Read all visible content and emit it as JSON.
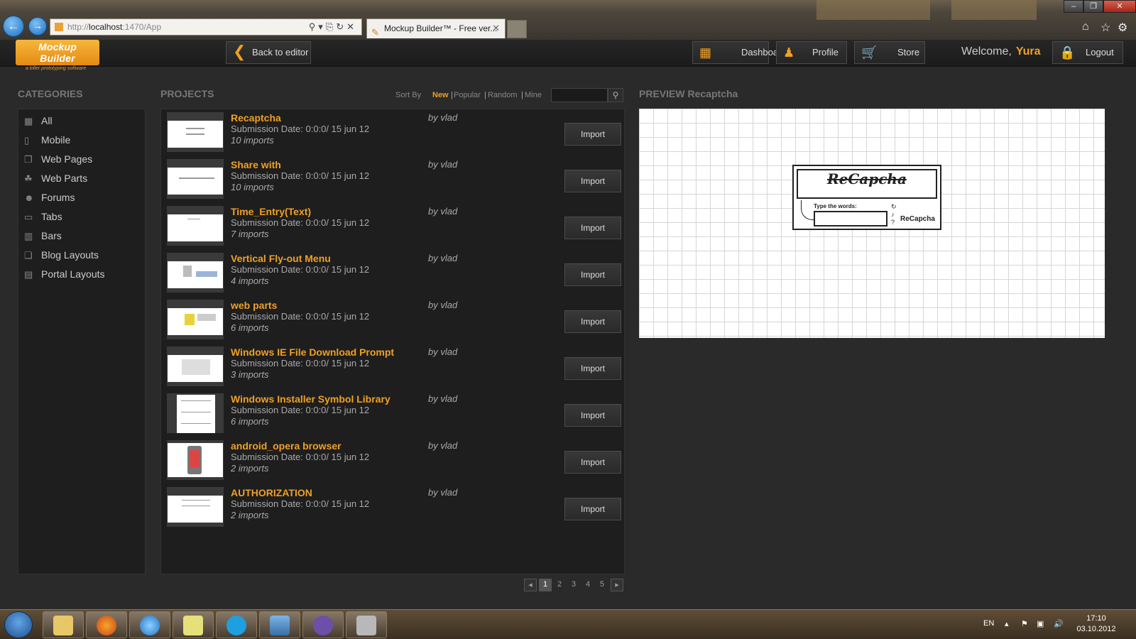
{
  "browser": {
    "url_prefix": "http://",
    "url_host": "localhost",
    "url_rest": ":1470/App",
    "tab_title": "Mockup Builder™ - Free ver...",
    "tab_close": "✕"
  },
  "app": {
    "logo_text": "Mockup Builder",
    "logo_subtitle": "a killer prototyping software",
    "back_label": "Back to editor",
    "dashboard_label": "Dashboard",
    "profile_label": "Profile",
    "store_label": "Store",
    "welcome_text": "Welcome,",
    "username": "Yura",
    "logout_label": "Logout",
    "accent_color": "#f0a024"
  },
  "categories": {
    "title": "CATEGORIES",
    "items": [
      {
        "label": "All",
        "icon": "grid-icon"
      },
      {
        "label": "Mobile",
        "icon": "phone-icon"
      },
      {
        "label": "Web Pages",
        "icon": "pages-icon"
      },
      {
        "label": "Web Parts",
        "icon": "puzzle-icon"
      },
      {
        "label": "Forums",
        "icon": "people-icon"
      },
      {
        "label": "Tabs",
        "icon": "tabs-icon"
      },
      {
        "label": "Bars",
        "icon": "bars-icon"
      },
      {
        "label": "Blog Layouts",
        "icon": "blog-icon"
      },
      {
        "label": "Portal Layouts",
        "icon": "portal-icon"
      }
    ]
  },
  "projects": {
    "title": "PROJECTS",
    "sort_label": "Sort By",
    "sort_options": [
      "New",
      "Popular",
      "Random",
      "Mine"
    ],
    "sort_active": "New",
    "import_label": "Import",
    "items": [
      {
        "title": "Recaptcha",
        "date": "Submission Date:  0:0:0/ 15 jun 12",
        "imports": "10 imports",
        "by": "by vlad"
      },
      {
        "title": "Share with",
        "date": "Submission Date:  0:0:0/ 15 jun 12",
        "imports": "10 imports",
        "by": "by vlad"
      },
      {
        "title": "Time_Entry(Text)",
        "date": "Submission Date:  0:0:0/ 15 jun 12",
        "imports": "7 imports",
        "by": "by vlad"
      },
      {
        "title": "Vertical Fly-out Menu",
        "date": "Submission Date:  0:0:0/ 15 jun 12",
        "imports": "4 imports",
        "by": "by vlad"
      },
      {
        "title": "web parts",
        "date": "Submission Date:  0:0:0/ 15 jun 12",
        "imports": "6 imports",
        "by": "by vlad"
      },
      {
        "title": "Windows IE File Download Prompt",
        "date": "Submission Date:  0:0:0/ 15 jun 12",
        "imports": "3 imports",
        "by": "by vlad"
      },
      {
        "title": "Windows Installer Symbol Library",
        "date": "Submission Date:  0:0:0/ 15 jun 12",
        "imports": "6 imports",
        "by": "by vlad"
      },
      {
        "title": "android_opera browser",
        "date": "Submission Date:  0:0:0/ 15 jun 12",
        "imports": "2 imports",
        "by": "by vlad"
      },
      {
        "title": "AUTHORIZATION",
        "date": "Submission Date:  0:0:0/ 15 jun 12",
        "imports": "2 imports",
        "by": "by vlad"
      }
    ],
    "pages": [
      "1",
      "2",
      "3",
      "4",
      "5"
    ],
    "current_page": "1"
  },
  "preview": {
    "label": "PREVIEW",
    "name": "Recaptcha",
    "recaptcha_heading": "ReCapcha",
    "type_label": "Type the words:",
    "brand": "ReCapcha"
  },
  "taskbar": {
    "lang": "EN",
    "time": "17:10",
    "date": "03.10.2012"
  }
}
